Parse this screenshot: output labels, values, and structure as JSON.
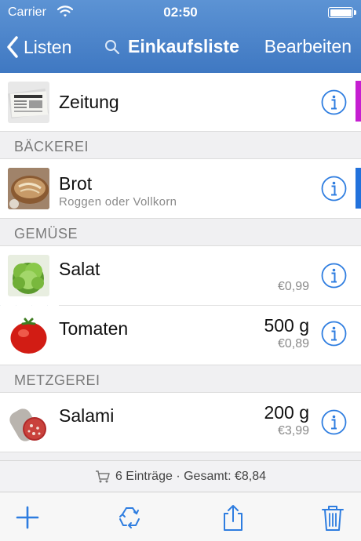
{
  "status_bar": {
    "carrier": "Carrier",
    "time": "02:50"
  },
  "nav": {
    "back_label": "Listen",
    "title": "Einkaufsliste",
    "edit_label": "Bearbeiten"
  },
  "colors": {
    "nav_bar": "#4a84ca",
    "tint": "#2e7de0",
    "marker_magenta": "#c51fd1",
    "marker_blue": "#2272dc"
  },
  "items": [
    {
      "name": "Zeitung",
      "image": "newspaper-thumbnail",
      "marker": "magenta"
    },
    {
      "section": "BÄCKEREI"
    },
    {
      "name": "Brot",
      "subtitle": "Roggen oder Vollkorn",
      "image": "bread-thumbnail",
      "marker": "blue"
    },
    {
      "section": "GEMÜSE"
    },
    {
      "name": "Salat",
      "price": "€0,99",
      "image": "lettuce-thumbnail"
    },
    {
      "name": "Tomaten",
      "quantity": "500 g",
      "price": "€0,89",
      "image": "tomato-thumbnail"
    },
    {
      "section": "METZGEREI"
    },
    {
      "name": "Salami",
      "quantity": "200 g",
      "price": "€3,99",
      "image": "salami-thumbnail"
    }
  ],
  "summary": {
    "text": "6 Einträge · Gesamt: €8,84"
  },
  "toolbar": {
    "icons": [
      "plus-icon",
      "recycle-icon",
      "share-icon",
      "trash-icon"
    ]
  }
}
